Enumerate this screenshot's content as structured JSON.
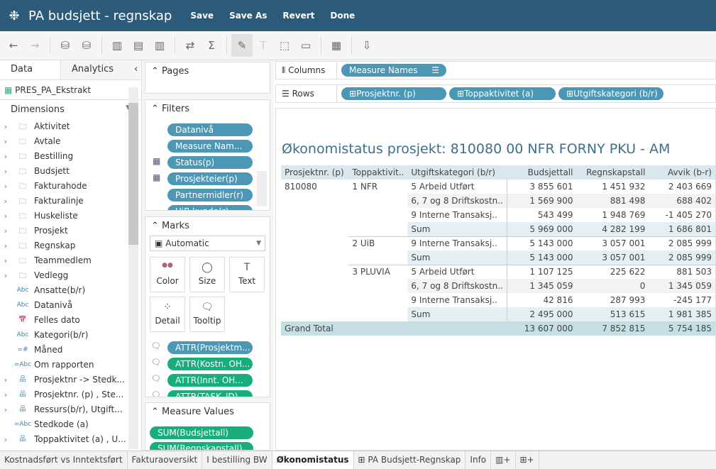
{
  "header": {
    "title": "PA budsjett - regnskap",
    "buttons": [
      "Save",
      "Save As",
      "Revert",
      "Done"
    ],
    "colors": {
      "bar": "#2c5a79"
    }
  },
  "toolbar": {
    "icons": [
      "back-icon",
      "forward-icon",
      "new-datasource-icon",
      "pause-updates-icon",
      "new-worksheet-icon",
      "duplicate-sheet-icon",
      "clear-sheet-icon",
      "swap-icon",
      "totals-icon",
      "highlight-icon",
      "labels-icon",
      "annotate-icon",
      "fit-icon",
      "show-me-icon",
      "download-icon"
    ]
  },
  "left": {
    "tabs": [
      "Data",
      "Analytics"
    ],
    "datasource": "PRES_PA_Ekstrakt",
    "dimensions_label": "Dimensions",
    "items": [
      {
        "icon": "folder",
        "label": "Aktivitet"
      },
      {
        "icon": "folder",
        "label": "Avtale"
      },
      {
        "icon": "folder",
        "label": "Bestilling"
      },
      {
        "icon": "folder",
        "label": "Budsjett"
      },
      {
        "icon": "folder",
        "label": "Fakturahode"
      },
      {
        "icon": "folder",
        "label": "Fakturalinje"
      },
      {
        "icon": "folder",
        "label": "Huskeliste"
      },
      {
        "icon": "folder",
        "label": "Prosjekt"
      },
      {
        "icon": "folder",
        "label": "Regnskap"
      },
      {
        "icon": "folder",
        "label": "Teammedlem"
      },
      {
        "icon": "folder",
        "label": "Vedlegg"
      },
      {
        "icon": "Abc",
        "label": "Ansatte(b/r)"
      },
      {
        "icon": "Abc",
        "label": "Datanivå"
      },
      {
        "icon": "date",
        "label": "Felles dato"
      },
      {
        "icon": "Abc",
        "label": "Kategori(b/r)"
      },
      {
        "icon": "=#",
        "label": "Måned"
      },
      {
        "icon": "=Abc",
        "label": "Om rapporten"
      },
      {
        "icon": "hierarchy",
        "label": "Prosjektnr -> Stedk..."
      },
      {
        "icon": "hierarchy",
        "label": "Prosjektnr. (p) , Ste..."
      },
      {
        "icon": "hierarchy",
        "label": "Ressurs(b/r), Utgift..."
      },
      {
        "icon": "=Abc",
        "label": "Stedkode (a)"
      },
      {
        "icon": "hierarchy",
        "label": "Toppaktivitet (a) , U..."
      }
    ]
  },
  "pages": {
    "label": "Pages"
  },
  "filters": {
    "label": "Filters",
    "pills": [
      "Datanivå",
      "Measure Nam...",
      "Status(p)",
      "Prosjekteier(p)",
      "Partnermidler(r)",
      "UiB kunde(r)"
    ]
  },
  "marks": {
    "label": "Marks",
    "type": "Automatic",
    "buttons": [
      "Color",
      "Size",
      "Text",
      "Detail",
      "Tooltip"
    ],
    "pills": [
      {
        "label": "ATTR(Prosjektm...",
        "color": "blue"
      },
      {
        "label": "ATTR(Kostn. OH...",
        "color": "green"
      },
      {
        "label": "ATTR(Innt. OH...",
        "color": "green"
      },
      {
        "label": "ATTR(TASK_ID)",
        "color": "green"
      }
    ]
  },
  "measure_values": {
    "label": "Measure Values",
    "pills": [
      "SUM(Budsjettall)",
      "SUM(Regnskapstall)"
    ]
  },
  "columns": {
    "label": "Columns",
    "pills": [
      "Measure Names"
    ]
  },
  "rows": {
    "label": "Rows",
    "pills": [
      "Prosjektnr. (p)",
      "Toppaktivitet (a)",
      "Utgiftskategori (b/r)"
    ]
  },
  "viz": {
    "title": "Økonomistatus prosjekt: 810080 00 NFR FORNY PKU - AM",
    "headers": [
      "Prosjektnr. (p)",
      "Toppaktivit..",
      "Utgiftskategori (b/r)",
      "Budsjettall",
      "Regnskapstall",
      "Avvik (b-r)"
    ],
    "rows": [
      [
        "810080",
        "1 NFR",
        "5 Arbeid Utført",
        "3 855 601",
        "1 451 932",
        "2 403 669"
      ],
      [
        "",
        "",
        "6, 7 og 8 Driftskostn..",
        "1 569 900",
        "881 498",
        "688 402"
      ],
      [
        "",
        "",
        "9 Interne Transaksj..",
        "543 499",
        "1 948 769",
        "-1 405 270"
      ],
      [
        "",
        "",
        "Sum",
        "5 969 000",
        "4 282 199",
        "1 686 801"
      ],
      [
        "",
        "2 UiB",
        "9 Interne Transaksj..",
        "5 143 000",
        "3 057 001",
        "2 085 999"
      ],
      [
        "",
        "",
        "Sum",
        "5 143 000",
        "3 057 001",
        "2 085 999"
      ],
      [
        "",
        "3 PLUVIA",
        "5 Arbeid Utført",
        "1 107 125",
        "225 622",
        "881 503"
      ],
      [
        "",
        "",
        "6, 7 og 8 Driftskostn..",
        "1 345 059",
        "0",
        "1 345 059"
      ],
      [
        "",
        "",
        "9 Interne Transaksj..",
        "42 816",
        "287 993",
        "-245 177"
      ],
      [
        "",
        "",
        "Sum",
        "2 495 000",
        "513 615",
        "1 981 385"
      ]
    ],
    "grand_total": [
      "Grand Total",
      "13 607 000",
      "7 852 815",
      "5 754 185"
    ]
  },
  "sheets": [
    "Kostnadsført vs Inntektsført",
    "Fakturaoversikt",
    "I bestilling BW",
    "Økonomistatus",
    "PA Budsjett-Regnskap",
    "Info"
  ],
  "active_sheet": "Økonomistatus"
}
